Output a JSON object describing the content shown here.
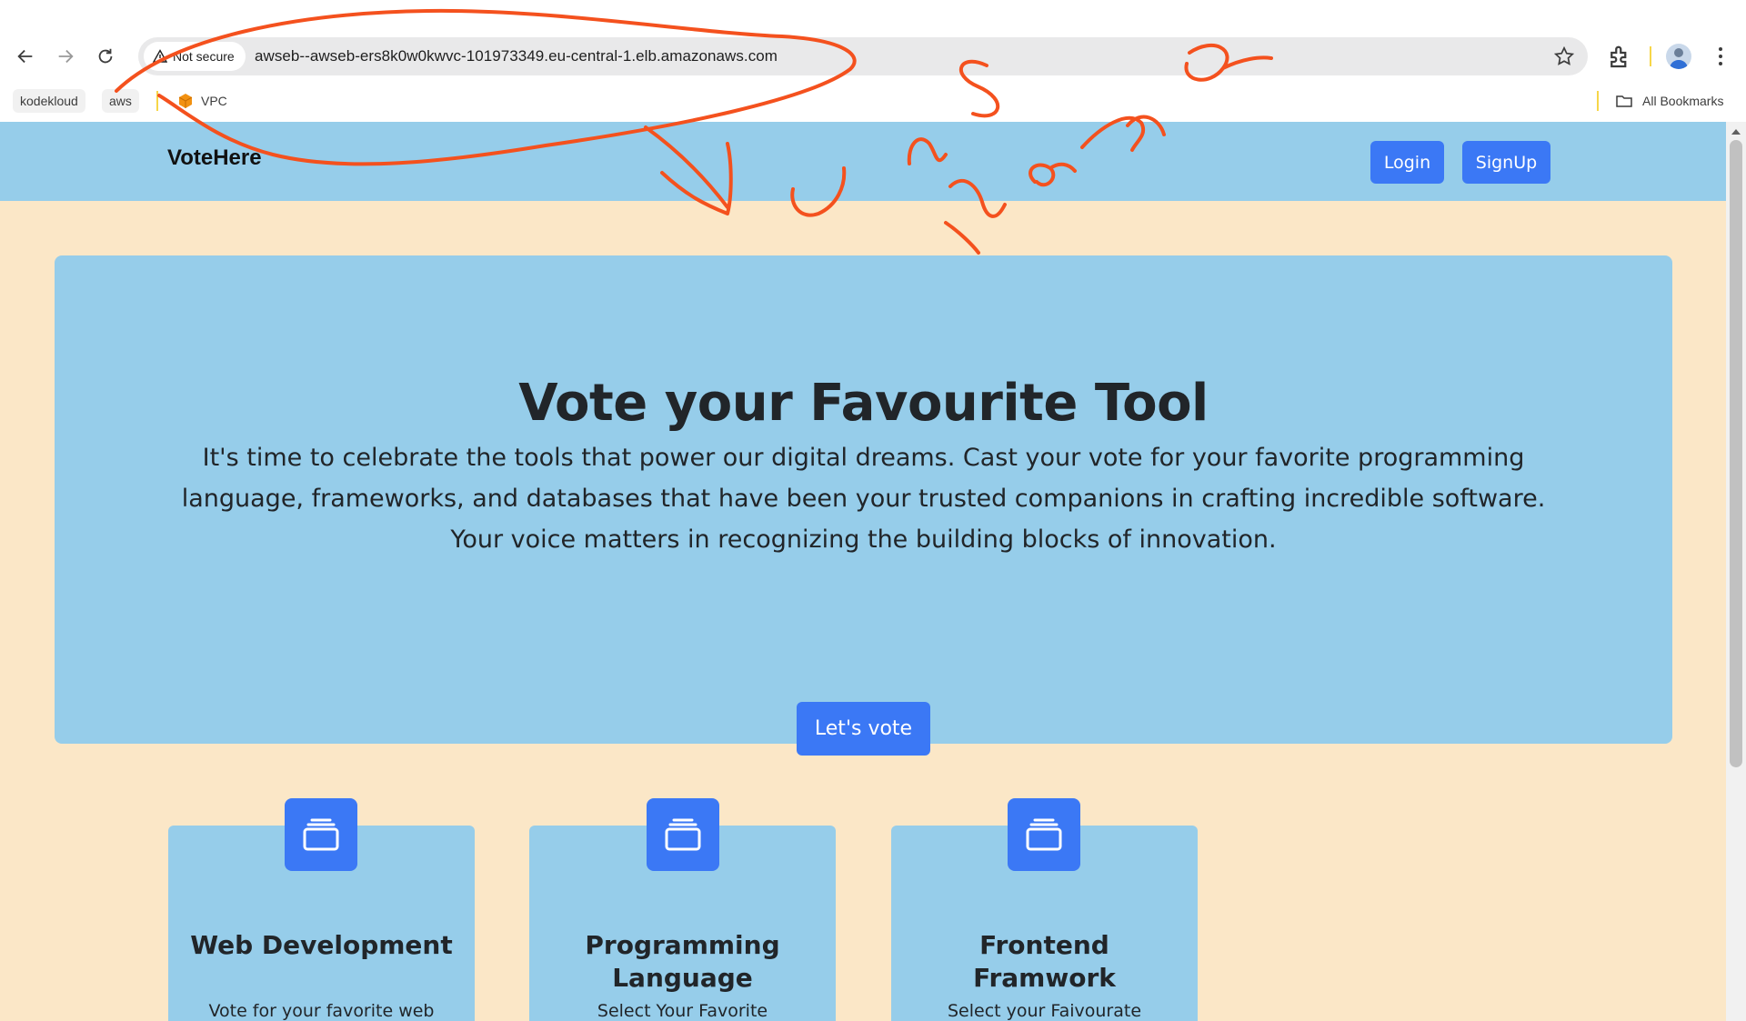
{
  "browser": {
    "security_label": "Not secure",
    "url": "awseb--awseb-ers8k0w0kwvc-101973349.eu-central-1.elb.amazonaws.com",
    "bookmarks": [
      "kodekloud",
      "aws",
      "VPC"
    ],
    "all_bookmarks_label": "All Bookmarks"
  },
  "site": {
    "brand": "VoteHere",
    "login_label": "Login",
    "signup_label": "SignUp"
  },
  "hero": {
    "title": "Vote your Favourite Tool",
    "description": "It's time to celebrate the tools that power our digital dreams. Cast your vote for your favorite programming language, frameworks, and databases that have been your trusted companions in crafting incredible software. Your voice matters in recognizing the building blocks of innovation.",
    "cta_label": "Let's vote"
  },
  "cards": [
    {
      "title": "Web Development",
      "description": "Vote for your favorite web Devlopment",
      "icon": "collection-icon"
    },
    {
      "title": "Programming Language",
      "description": "Select Your Favorite programming language",
      "icon": "collection-icon"
    },
    {
      "title": "Frontend Framwork",
      "description": "Select your Faivourate frontend framework",
      "icon": "collection-icon"
    }
  ],
  "colors": {
    "page_background": "#fbe7c7",
    "panel_blue": "#96cdea",
    "accent_button": "#3b78f5",
    "annotation_ink": "#f4511e"
  }
}
